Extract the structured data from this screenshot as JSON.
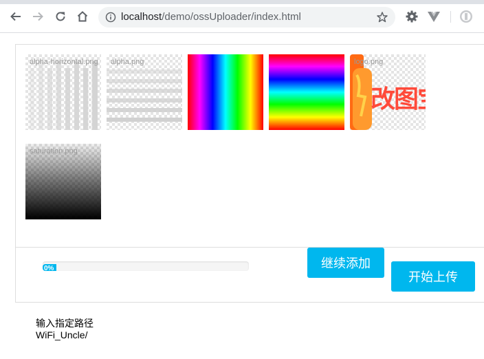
{
  "browser": {
    "url_host": "localhost",
    "url_path": "/demo/ossUploader/index.html"
  },
  "thumbnails": [
    {
      "caption": "alpha-horizontal.png"
    },
    {
      "caption": "alpha.png"
    },
    {
      "caption": ""
    },
    {
      "caption": ""
    },
    {
      "caption": "logo.png",
      "logo_text": "改图宝"
    },
    {
      "caption": "saturation.png"
    }
  ],
  "progress": {
    "value": 0,
    "label": "0%"
  },
  "buttons": {
    "add_more": "继续添加",
    "start_upload": "开始上传"
  },
  "path": {
    "label": "输入指定路径",
    "value": "WiFi_Uncle/"
  },
  "colors": {
    "accent": "#00b7ee"
  }
}
